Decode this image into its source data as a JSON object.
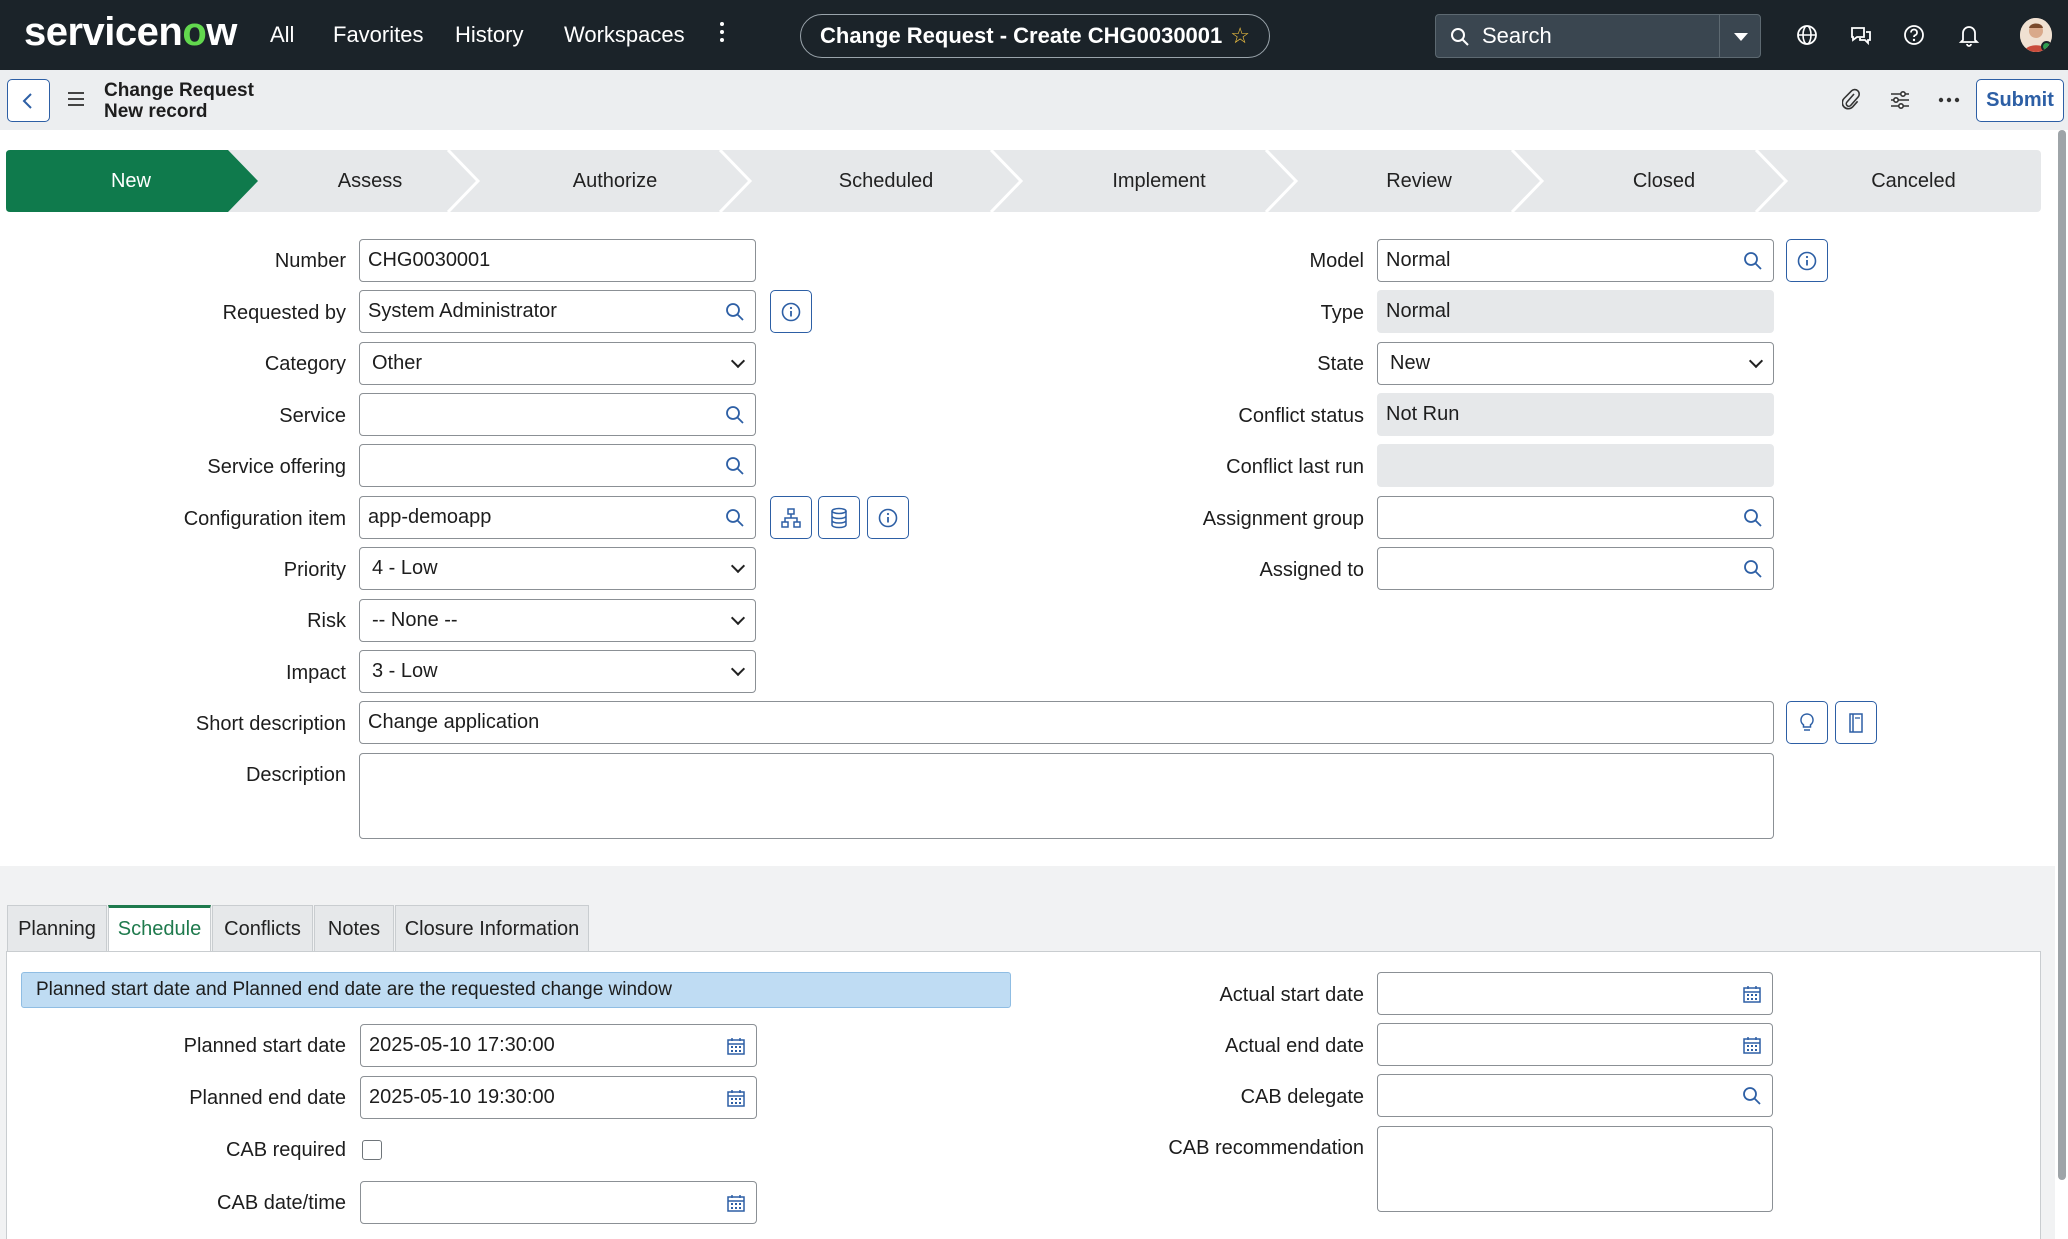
{
  "nav": {
    "logo_text": "servicenow",
    "links": [
      "All",
      "Favorites",
      "History",
      "Workspaces"
    ],
    "title": "Change Request - Create CHG0030001",
    "search_placeholder": "Search",
    "icons": [
      "globe-icon",
      "chat-icon",
      "help-icon",
      "bell-icon",
      "avatar"
    ]
  },
  "record_header": {
    "table_label": "Change Request",
    "record_label": "New record",
    "submit_label": "Submit",
    "icons": [
      "back-icon",
      "menu-icon",
      "attachment-icon",
      "settings-sliders-icon",
      "more-icon"
    ]
  },
  "process_flow": {
    "active_color": "#0f7a4c",
    "steps": [
      "New",
      "Assess",
      "Authorize",
      "Scheduled",
      "Implement",
      "Review",
      "Closed",
      "Canceled"
    ],
    "active_index": 0
  },
  "form": {
    "number": {
      "label": "Number",
      "value": "CHG0030001"
    },
    "requested_by": {
      "label": "Requested by",
      "value": "System Administrator"
    },
    "category": {
      "label": "Category",
      "value": "Other"
    },
    "service": {
      "label": "Service",
      "value": ""
    },
    "service_offering": {
      "label": "Service offering",
      "value": ""
    },
    "configuration_item": {
      "label": "Configuration item",
      "value": "app-demoapp"
    },
    "priority": {
      "label": "Priority",
      "value": "4 - Low"
    },
    "risk": {
      "label": "Risk",
      "value": "-- None --"
    },
    "impact": {
      "label": "Impact",
      "value": "3 - Low"
    },
    "short_description": {
      "label": "Short description",
      "value": "Change application"
    },
    "description": {
      "label": "Description",
      "value": ""
    },
    "model": {
      "label": "Model",
      "value": "Normal"
    },
    "type": {
      "label": "Type",
      "value": "Normal"
    },
    "state": {
      "label": "State",
      "value": "New"
    },
    "conflict_status": {
      "label": "Conflict status",
      "value": "Not Run"
    },
    "conflict_last_run": {
      "label": "Conflict last run",
      "value": ""
    },
    "assignment_group": {
      "label": "Assignment group",
      "value": ""
    },
    "assigned_to": {
      "label": "Assigned to",
      "value": ""
    }
  },
  "tabs": {
    "items": [
      "Planning",
      "Schedule",
      "Conflicts",
      "Notes",
      "Closure Information"
    ],
    "active_index": 1
  },
  "schedule": {
    "info_message": "Planned start date and Planned end date are the requested change window",
    "planned_start": {
      "label": "Planned start date",
      "value": "2025-05-10 17:30:00"
    },
    "planned_end": {
      "label": "Planned end date",
      "value": "2025-05-10 19:30:00"
    },
    "cab_required": {
      "label": "CAB required",
      "checked": false
    },
    "cab_date_time": {
      "label": "CAB date/time",
      "value": ""
    },
    "actual_start": {
      "label": "Actual start date",
      "value": ""
    },
    "actual_end": {
      "label": "Actual end date",
      "value": ""
    },
    "cab_delegate": {
      "label": "CAB delegate",
      "value": ""
    },
    "cab_recommendation": {
      "label": "CAB recommendation",
      "value": ""
    }
  }
}
